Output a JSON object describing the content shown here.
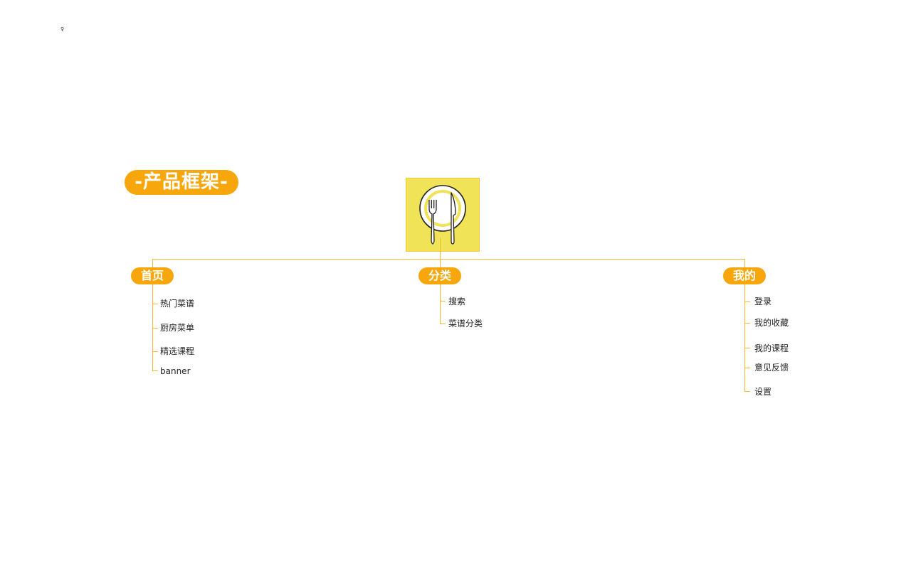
{
  "corner_mark": "♀",
  "title": "-产品框架-",
  "colors": {
    "accent": "#f7a70b",
    "connector": "#f7b733",
    "logo_background": "#f0e357",
    "text": "#222222"
  },
  "logo": {
    "icon": "plate-fork-knife-icon"
  },
  "branches": [
    {
      "label": "首页",
      "items": [
        "热门菜谱",
        "厨房菜单",
        "精选课程",
        "banner"
      ]
    },
    {
      "label": "分类",
      "items": [
        "搜索",
        "菜谱分类"
      ]
    },
    {
      "label": "我的",
      "items": [
        "登录",
        "我的收藏",
        "我的课程",
        "意见反馈",
        "设置"
      ]
    }
  ]
}
